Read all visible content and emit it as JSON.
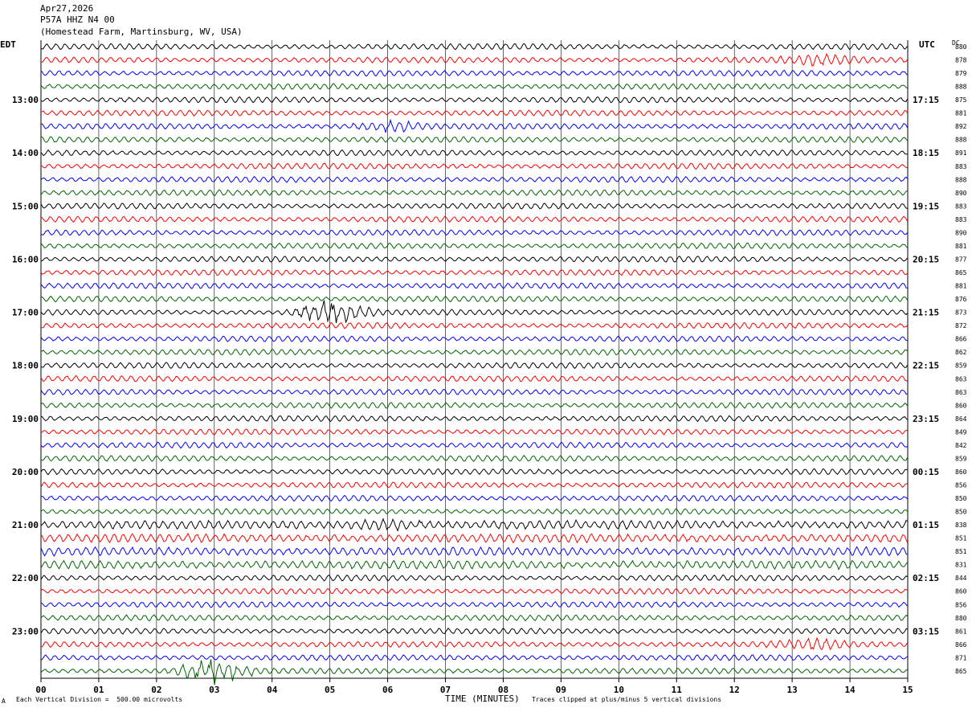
{
  "header": {
    "date": "Apr27,2026",
    "station": "P57A HHZ N4 00",
    "location": "(Homestead Farm, Martinsburg, WV, USA)"
  },
  "left_timezone": "EDT",
  "right_timezone": "UTC",
  "dc_label": "DC",
  "footer": {
    "scale": "Each Vertical Division =  500.00 microvolts",
    "clip": "Traces clipped at plus/minus 5 vertical divisions",
    "corner": "A"
  },
  "colors": {
    "trace_cycle": [
      "#000000",
      "#ff0000",
      "#0000ff",
      "#006400"
    ],
    "grid": "#000000"
  },
  "chart_data": {
    "type": "line",
    "title": "P57A HHZ N4 00",
    "xlabel": "TIME (MINUTES)",
    "ylabel": "",
    "xlim": [
      0,
      15
    ],
    "x_ticks": [
      "00",
      "01",
      "02",
      "03",
      "04",
      "05",
      "06",
      "07",
      "08",
      "09",
      "10",
      "11",
      "12",
      "13",
      "14",
      "15"
    ],
    "left_hour_labels": [
      "13:00",
      "14:00",
      "15:00",
      "16:00",
      "17:00",
      "18:00",
      "19:00",
      "20:00",
      "21:00",
      "22:00",
      "23:00"
    ],
    "right_hour_labels": [
      "17:15",
      "18:15",
      "19:15",
      "20:15",
      "21:15",
      "22:15",
      "23:15",
      "00:15",
      "01:15",
      "02:15",
      "03:15"
    ],
    "first_labeled_row": 4,
    "rows_per_hour": 4,
    "dc_offsets": [
      880,
      878,
      879,
      888,
      875,
      881,
      892,
      888,
      891,
      883,
      888,
      890,
      883,
      883,
      890,
      881,
      877,
      865,
      881,
      876,
      873,
      872,
      866,
      862,
      859,
      863,
      863,
      860,
      864,
      849,
      842,
      859,
      860,
      856,
      850,
      850,
      838,
      851,
      851,
      831,
      844,
      860,
      856,
      880,
      861,
      866,
      871,
      865
    ],
    "events": [
      {
        "row": 1,
        "x_min": 13.5,
        "note": "red burst"
      },
      {
        "row": 6,
        "x_min": 6.0,
        "note": "blue noise band"
      },
      {
        "row": 20,
        "x_min": 5.0,
        "note": "large black spikes"
      },
      {
        "row": 36,
        "x_min": 6.0,
        "note": "noisy hour"
      },
      {
        "row": 45,
        "x_min": 13.3,
        "note": "red burst"
      },
      {
        "row": 47,
        "x_min": 3.0,
        "note": "green spikes"
      }
    ]
  }
}
